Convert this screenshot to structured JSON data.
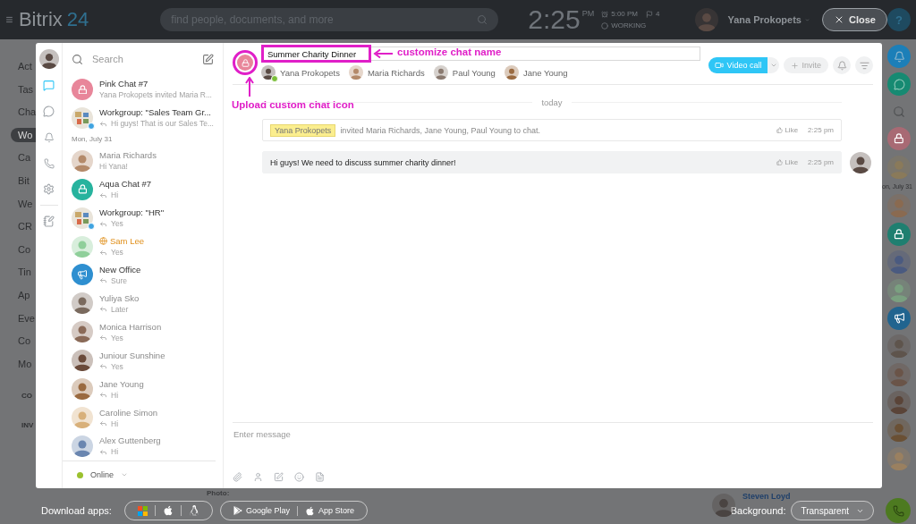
{
  "topbar": {
    "logo": "Bitrix",
    "logo_number": "24",
    "search": {
      "placeholder": "find people, documents, and more"
    },
    "time": "2:25",
    "time_suffix": "PM",
    "alarm": "5:00 PM",
    "flags": "4",
    "status": "WORKING",
    "user": "Yana Prokopets",
    "close": "Close",
    "help": "?"
  },
  "background_menu": [
    {
      "label": "Act",
      "selected": false
    },
    {
      "label": "Tas",
      "selected": false
    },
    {
      "label": "Cha",
      "selected": false
    },
    {
      "label": "Wo",
      "selected": true
    },
    {
      "label": "Ca",
      "selected": false
    },
    {
      "label": "Bit",
      "selected": false
    },
    {
      "label": "We",
      "selected": false
    },
    {
      "label": "CR",
      "selected": false
    },
    {
      "label": "Co",
      "selected": false
    },
    {
      "label": "Tin",
      "selected": false
    },
    {
      "label": "Ap",
      "selected": false
    },
    {
      "label": "Eve",
      "selected": false
    },
    {
      "label": "Co",
      "selected": false
    },
    {
      "label": "Mo",
      "selected": false
    }
  ],
  "background_sections": [
    "CO",
    "INV"
  ],
  "nav_rail": [
    {
      "kind": "chat",
      "selected": true
    },
    {
      "kind": "history",
      "selected": false
    },
    {
      "kind": "bell",
      "selected": false
    },
    {
      "kind": "phone",
      "selected": false
    },
    {
      "kind": "settings",
      "selected": false
    },
    {
      "kind": "notes",
      "selected": false
    }
  ],
  "chat_list": {
    "search": {
      "placeholder": "Search"
    },
    "items": [
      {
        "kind": "lock",
        "title": "Pink Chat #7",
        "preview": "Yana Prokopets invited Maria R...",
        "color": "#e8869a",
        "replied": false,
        "muted": false,
        "extranet": false,
        "group": false
      },
      {
        "kind": "group",
        "title": "Workgroup: \"Sales Team Gr...",
        "preview": "Hi guys! That is our Sales Te...",
        "replied": true,
        "muted": false,
        "extranet": false,
        "group": true
      },
      {
        "kind": "date",
        "title": "Mon, July 31"
      },
      {
        "kind": "photo",
        "title": "Maria Richards",
        "preview": "Hi Yana!",
        "color": "#b48a6a",
        "replied": false,
        "muted": true,
        "extranet": false,
        "group": false
      },
      {
        "kind": "lock",
        "title": "Aqua Chat #7",
        "preview": "Hi",
        "color": "#27b39e",
        "replied": true,
        "muted": false,
        "extranet": false,
        "group": false
      },
      {
        "kind": "group",
        "title": "Workgroup: \"HR\"",
        "preview": "Yes",
        "replied": true,
        "muted": false,
        "extranet": false,
        "group": true
      },
      {
        "kind": "photo",
        "title": "Sam Lee",
        "preview": "Yes",
        "color": "#8fcf9a",
        "replied": true,
        "muted": false,
        "extranet": true,
        "group": false
      },
      {
        "kind": "megaphone",
        "title": "New Office",
        "preview": "Sure",
        "color": "#2e8fd0",
        "replied": true,
        "muted": false,
        "extranet": false,
        "group": false
      },
      {
        "kind": "photo",
        "title": "Yuliya Sko",
        "preview": "Later",
        "color": "#7a6a5e",
        "replied": true,
        "muted": true,
        "extranet": false,
        "group": false
      },
      {
        "kind": "photo",
        "title": "Monica Harrison",
        "preview": "Yes",
        "color": "#8a6a58",
        "replied": true,
        "muted": true,
        "extranet": false,
        "group": false
      },
      {
        "kind": "photo",
        "title": "Juniour Sunshine",
        "preview": "Yes",
        "color": "#6a4a3a",
        "replied": true,
        "muted": true,
        "extranet": false,
        "group": false
      },
      {
        "kind": "photo",
        "title": "Jane Young",
        "preview": "Hi",
        "color": "#9a6a40",
        "replied": true,
        "muted": true,
        "extranet": false,
        "group": false
      },
      {
        "kind": "photo",
        "title": "Caroline Simon",
        "preview": "Hi",
        "color": "#d8b07a",
        "replied": true,
        "muted": true,
        "extranet": false,
        "group": false
      },
      {
        "kind": "photo",
        "title": "Alex Guttenberg",
        "preview": "Hi",
        "color": "#6a86b0",
        "replied": true,
        "muted": true,
        "extranet": false,
        "group": false
      }
    ],
    "status": {
      "label": "Online",
      "color": "#9bc12e"
    }
  },
  "chat": {
    "name": "Summer Charity Dinner",
    "members": [
      {
        "name": "Yana Prokopets",
        "owner": true
      },
      {
        "name": "Maria Richards",
        "owner": false
      },
      {
        "name": "Paul Young",
        "owner": false
      },
      {
        "name": "Jane Young",
        "owner": false
      }
    ],
    "video_call": "Video call",
    "invite": "Invite",
    "annotations": {
      "name_hint": "customize chat name",
      "icon_hint": "Upload custom chat icon"
    },
    "date": "today",
    "messages": [
      {
        "kind": "system",
        "author": "Yana Prokopets",
        "text": "invited Maria Richards, Jane Young, Paul Young to chat.",
        "like": "Like",
        "time": "2:25 pm"
      },
      {
        "kind": "user",
        "text": "Hi guys! We need to discuss summer charity dinner!",
        "like": "Like",
        "time": "2:25 pm"
      }
    ],
    "composer": {
      "placeholder": "Enter message"
    }
  },
  "right_rail": [
    {
      "kind": "bell",
      "color": "#1c7fb8"
    },
    {
      "kind": "chat",
      "color": "#168a72"
    },
    {
      "kind": "search"
    },
    {
      "kind": "lock",
      "color": "#a86a74"
    },
    {
      "kind": "photo",
      "color": "#8a7a5a"
    },
    {
      "kind": "date",
      "text": "on, July 31"
    },
    {
      "kind": "photo",
      "color": "#8a6a50"
    },
    {
      "kind": "lock",
      "color": "#1f7f70"
    },
    {
      "kind": "photo",
      "color": "#4a5a80"
    },
    {
      "kind": "photo",
      "color": "#7aa080"
    },
    {
      "kind": "megaphone",
      "color": "#21648f"
    },
    {
      "kind": "photo",
      "color": "#5e544c"
    },
    {
      "kind": "photo",
      "color": "#6a5448"
    },
    {
      "kind": "photo",
      "color": "#5a4438"
    },
    {
      "kind": "photo",
      "color": "#6a5034"
    },
    {
      "kind": "photo",
      "color": "#9a8060"
    }
  ],
  "bottom": {
    "download_label": "Download apps:",
    "platforms": [
      {
        "kind": "windows"
      },
      {
        "kind": "apple"
      },
      {
        "kind": "linux"
      }
    ],
    "stores": [
      {
        "kind": "google",
        "label": "Google Play"
      },
      {
        "kind": "apple",
        "label": "App Store"
      }
    ],
    "photo_label": "Photo:",
    "person": "Steven Loyd",
    "background_label": "Background:",
    "background_value": "Transparent"
  }
}
